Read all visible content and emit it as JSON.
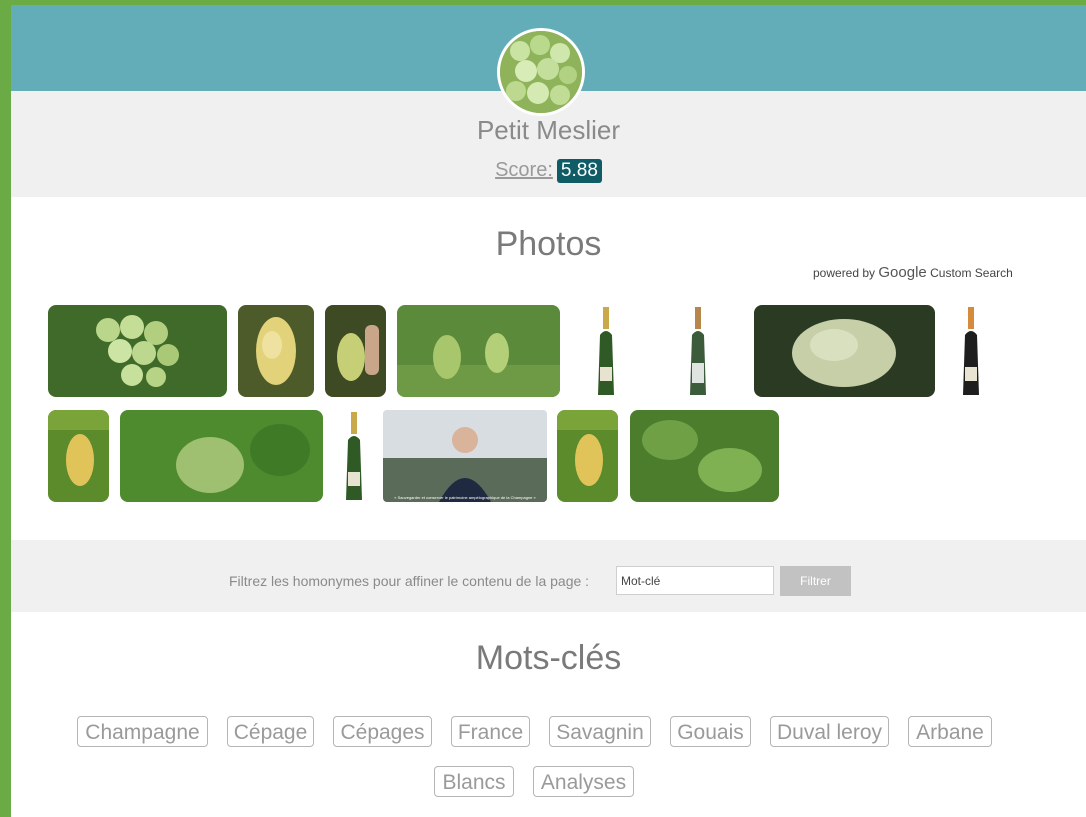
{
  "header": {
    "title": "Petit Meslier",
    "score_label": "Score:",
    "score_value": "5.88"
  },
  "photos": {
    "title": "Photos",
    "powered_prefix": "powered by",
    "powered_brand": "Google",
    "powered_suffix": "Custom Search",
    "video_caption": "« Sauvegarder et conserver le patrimoine ampélographique de la Champagne »"
  },
  "filter": {
    "label": "Filtrez les homonymes pour affiner le contenu de la page :",
    "input_value": "Mot-clé",
    "button_label": "Filtrer"
  },
  "keywords": {
    "title": "Mots-clés",
    "items": [
      "Champagne",
      "Cépage",
      "Cépages",
      "France",
      "Savagnin",
      "Gouais",
      "Duval leroy",
      "Arbane",
      "Blancs",
      "Analyses"
    ]
  },
  "colors": {
    "banner": "#62adb8",
    "score_badge": "#0f5b66",
    "frame": "#6aab45"
  }
}
